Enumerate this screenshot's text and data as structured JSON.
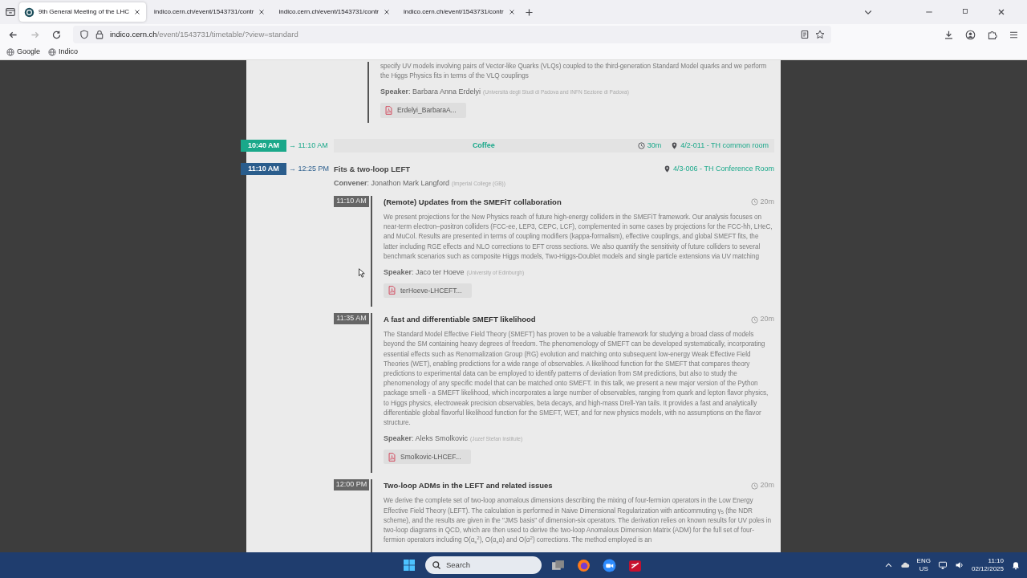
{
  "browser": {
    "tabs": [
      {
        "label": "9th General Meeting of the LHC",
        "selected": true
      },
      {
        "label": "indico.cern.ch/event/1543731/contr",
        "selected": false
      },
      {
        "label": "indico.cern.ch/event/1543731/contr",
        "selected": false
      },
      {
        "label": "indico.cern.ch/event/1543731/contr",
        "selected": false
      }
    ],
    "url_host": "indico.cern.ch",
    "url_path": "/event/1543731/timetable/?view=standard",
    "bookmarks": [
      "Google",
      "Indico"
    ]
  },
  "timetable": {
    "previous_contribution": {
      "description": "specify UV models involving pairs of Vector-like Quarks (VLQs) coupled to the third-generation Standard Model quarks and we perform the Higgs Physics fits in terms of the VLQ couplings",
      "speaker": "**Speaker**: Barbara Anna Erdelyi",
      "affiliation": "(Università degli Studi di Padova and INFN Sezione di Padova)",
      "attachment": "Erdelyi_BarbaraA..."
    },
    "entries": [
      {
        "kind": "break",
        "start": "10:40 AM",
        "end": "→ 11:10 AM",
        "color": "#1aa88a",
        "title": "Coffee",
        "duration": "30m",
        "location": "4/2-011 - TH common room"
      },
      {
        "kind": "session",
        "start": "11:10 AM",
        "end": "→ 12:25 PM",
        "color": "#2a5d8c",
        "title": "Fits & two-loop LEFT",
        "location": "4/3-006 - TH Conference Room",
        "convener": "**Convener**: Jonathon Mark Langford",
        "affiliation": "(Imperial College (GB))",
        "contributions": [
          {
            "time": "11:10 AM",
            "title": "(Remote) Updates from the SMEFiT collaboration",
            "duration": "20m",
            "description": "We present projections for the New Physics reach of future high-energy colliders in the SMEFiT framework. Our analysis focuses on near-term electron–positron colliders (FCC-ee, LEP3, CEPC, LCF), complemented in some cases by projections for the FCC-hh, LHeC, and MuCol. Results are presented in terms of coupling modifiers (kappa-formalism), effective couplings, and global SMEFT fits, the latter including RGE effects and NLO corrections to EFT cross sections. We also quantify the sensitivity of future colliders to several benchmark scenarios such as composite Higgs models, Two-Higgs-Doublet models and single particle extensions via UV matching",
            "speaker": "**Speaker**: Jaco ter Hoeve",
            "affiliation": "(University of Edinburgh)",
            "attachment": "terHoeve-LHCEFT..."
          },
          {
            "time": "11:35 AM",
            "title": "A fast and differentiable SMEFT likelihood",
            "duration": "20m",
            "description": "The Standard Model Effective Field Theory (SMEFT) has proven to be a valuable framework for studying a broad class of models beyond the SM containing heavy degrees of freedom. The phenomenology of SMEFT can be developed systematically, incorporating essential effects such as Renormalization Group (RG) evolution and matching onto subsequent low-energy Weak Effective Field Theories (WET), enabling predictions for a wide range of observables. A likelihood function for the SMEFT that compares theory predictions to experimental data can be employed to identify patterns of deviation from SM predictions, but also to study the phenomenology of any specific model that can be matched onto SMEFT. In this talk, we present a new major version of the Python package smelli - a SMEFT likelihood, which incorporates a large number of observables, ranging from quark and lepton flavor physics, to Higgs physics, electroweak precision observables, beta decays, and high-mass Drell-Yan tails. It provides a fast and analytically differentiable global flavorful likelihood function for the SMEFT, WET, and for new physics models, with no assumptions on the flavor structure.",
            "speaker": "**Speaker**: Aleks Smolkovic",
            "affiliation": "(Jozef Stefan Institute)",
            "attachment": "Smolkovic-LHCEF..."
          },
          {
            "time": "12:00 PM",
            "title": "Two-loop ADMs in the LEFT and related issues",
            "duration": "20m",
            "description": "We derive the complete set of two-loop anomalous dimensions describing the mixing of four-fermion operators in the Low Energy Effective Field Theory (LEFT). The calculation is performed in Naive Dimensional Regularization with anticommuting γ$_{5}$ (the NDR scheme), and the results are given in the \"JMS basis\" of dimension-six operators. The derivation relies on known results for UV poles in two-loop diagrams in QCD, which are then used to derive the two-loop Anomalous Dimension Matrix (ADM) for the full set of four-fermion operators including O(α$_{s}$$^{2}$), O(α$_{s}$α) and O(α$^{2}$) corrections. The method employed is an"
          }
        ]
      }
    ]
  },
  "taskbar": {
    "search_placeholder": "Search",
    "language": "ENG",
    "region": "US",
    "time": "11:10",
    "date": "02/12/2025"
  }
}
